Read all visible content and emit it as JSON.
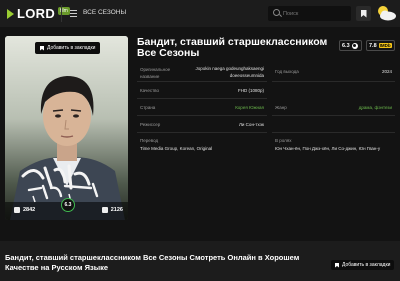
{
  "header": {
    "logo_text": "LORD",
    "logo_badge": "film",
    "nav_all_label": "ВСЕ СЕЗОНЫ",
    "search_placeholder": "Поиск"
  },
  "poster": {
    "bookmark_label": "Добавить в закладки",
    "likes": "2842",
    "dislikes": "2126",
    "score": "6.3"
  },
  "title": "Бандит, ставший старшеклассником Все Сезоны",
  "ratings": {
    "kp": "6.3",
    "imdb": "7.8",
    "imdb_label": "IMDb"
  },
  "info_left": {
    "original_name_label": "Оригинальное название",
    "original_name_value_1": "Jopokin naega godeunghaksaengi",
    "original_name_value_2": "doeeosseumnida",
    "quality_label": "Качество",
    "quality_value": "FHD (1080p)",
    "country_label": "Страна",
    "country_value": "Корея Южная",
    "director_label": "Режиссер",
    "director_value": "Ли Сон-тхэк",
    "translation_label": "Перевод",
    "translation_value": "Time Media Group, Korean, Original"
  },
  "info_right": {
    "year_label": "Год выхода",
    "year_value": "2024",
    "genre_label": "Жанр",
    "genre_value": "драма, фэнтези",
    "cast_label": "В ролях",
    "cast_value": "Юн Чхан-ён, Пон Джэ-хён, Ли Со-джин, Юн Гван-у"
  },
  "seo_title": "Бандит, ставший старшеклассником Все Сезоны Смотреть Онлайн в Хорошем Качестве на Русском Языке",
  "bottom_bookmark_label": "Добавить в закладки",
  "colors": {
    "accent_green": "#9acd32",
    "genre_green": "#6bb84c",
    "imdb_yellow": "#f5c518",
    "background": "#131313"
  }
}
